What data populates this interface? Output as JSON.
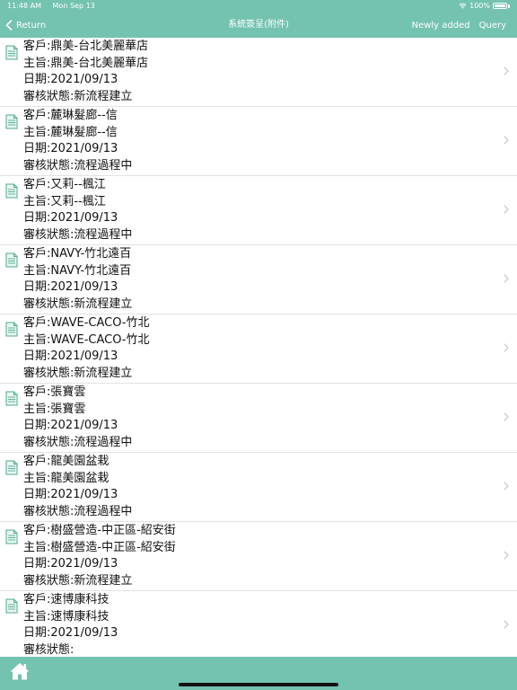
{
  "status": {
    "time": "11:48 AM",
    "date": "Mon Sep 13",
    "battery": "100%",
    "battery_level": 1.0
  },
  "nav": {
    "back_label": "Return",
    "title": "系統簽呈(附件)",
    "new_label": "Newly added",
    "query_label": "Query"
  },
  "labels": {
    "customer": "客戶:",
    "subject": "主旨:",
    "date": "日期:",
    "status": "審核狀態:"
  },
  "items": [
    {
      "customer": "鼎美-台北美麗華店",
      "subject": "鼎美-台北美麗華店",
      "date": "2021/09/13",
      "status": "新流程建立"
    },
    {
      "customer": "麓琳髮廊--信",
      "subject": "麓琳髮廊--信",
      "date": "2021/09/13",
      "status": "流程過程中"
    },
    {
      "customer": "又莉--楓江",
      "subject": "又莉--楓江",
      "date": "2021/09/13",
      "status": "流程過程中"
    },
    {
      "customer": "NAVY-竹北遠百",
      "subject": "NAVY-竹北遠百",
      "date": "2021/09/13",
      "status": "新流程建立"
    },
    {
      "customer": "WAVE-CACO-竹北",
      "subject": "WAVE-CACO-竹北",
      "date": "2021/09/13",
      "status": "新流程建立"
    },
    {
      "customer": "張寶雲",
      "subject": "張寶雲",
      "date": "2021/09/13",
      "status": "流程過程中"
    },
    {
      "customer": "龍美園盆栽",
      "subject": "龍美園盆栽",
      "date": "2021/09/13",
      "status": "流程過程中"
    },
    {
      "customer": "樹盛營造-中正區-紹安街",
      "subject": "樹盛營造-中正區-紹安街",
      "date": "2021/09/13",
      "status": "新流程建立"
    },
    {
      "customer": "速博康科技",
      "subject": "速博康科技",
      "date": "2021/09/13",
      "status": ""
    }
  ],
  "icons": {
    "back": "chevron-left-icon",
    "row": "document-icon",
    "disclosure": "chevron-right-icon",
    "home": "home-icon"
  },
  "colors": {
    "bar": "#74c2b0",
    "icon": "#4fa98f",
    "divider": "#e2e2e2",
    "chevron": "#c4c4c4"
  }
}
